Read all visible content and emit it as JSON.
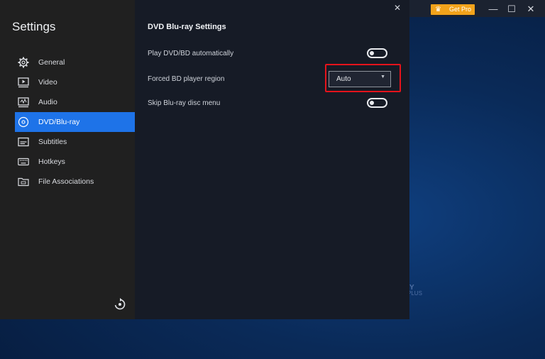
{
  "window": {
    "get_pro_label": "Get Pro",
    "minimize_glyph": "—",
    "maximize_glyph": "☐",
    "close_glyph": "✕",
    "watermark_y": "Y",
    "watermark_plus": "PLUS"
  },
  "dialog": {
    "close_glyph": "✕"
  },
  "sidebar": {
    "title": "Settings",
    "items": [
      {
        "label": "General",
        "icon": "gear-icon",
        "active": false
      },
      {
        "label": "Video",
        "icon": "video-icon",
        "active": false
      },
      {
        "label": "Audio",
        "icon": "audio-icon",
        "active": false
      },
      {
        "label": "DVD/Blu-ray",
        "icon": "disc-icon",
        "active": true
      },
      {
        "label": "Subtitles",
        "icon": "subtitles-icon",
        "active": false
      },
      {
        "label": "Hotkeys",
        "icon": "keyboard-icon",
        "active": false
      },
      {
        "label": "File Associations",
        "icon": "folder-icon",
        "active": false
      }
    ]
  },
  "content": {
    "section_title": "DVD Blu-ray Settings",
    "rows": [
      {
        "label": "Play DVD/BD automatically",
        "control": "toggle",
        "value": "off"
      },
      {
        "label": "Forced BD player region",
        "control": "dropdown",
        "value": "Auto"
      },
      {
        "label": "Skip Blu-ray disc menu",
        "control": "toggle",
        "value": "off"
      }
    ]
  },
  "colors": {
    "accent": "#1e73e8",
    "get_pro": "#f2a31b",
    "highlight": "#e5131b"
  }
}
